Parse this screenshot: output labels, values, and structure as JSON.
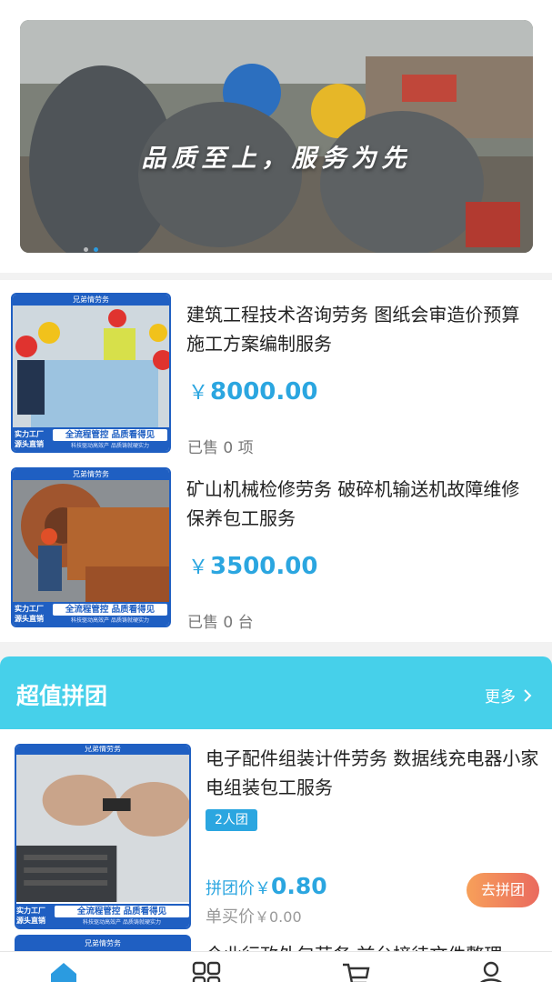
{
  "banner": {
    "slogan": "品质至上，服务为先",
    "dots": 2,
    "active_dot": 1
  },
  "products": [
    {
      "thumb_brand": "兄弟情劳务",
      "thumb_badge_left": "实力工厂 源头直销",
      "thumb_badge_right": "全流程管控 品质看得见",
      "thumb_badge_sub": "科技驱动高效产 品质铸就硬实力",
      "title": "建筑工程技术咨询劳务 图纸会审造价预算施工方案编制服务",
      "price_symbol": "￥",
      "price": "8000.00",
      "sold": "已售 0 项"
    },
    {
      "thumb_brand": "兄弟情劳务",
      "thumb_badge_left": "实力工厂 源头直销",
      "thumb_badge_right": "全流程管控 品质看得见",
      "thumb_badge_sub": "科技驱动高效产 品质铸就硬实力",
      "title": "矿山机械检修劳务 破碎机输送机故障维修保养包工服务",
      "price_symbol": "￥",
      "price": "3500.00",
      "sold": "已售 0 台"
    }
  ],
  "group_buy": {
    "title": "超值拼团",
    "more": "更多",
    "item": {
      "thumb_brand": "兄弟情劳务",
      "thumb_badge_left": "实力工厂 源头直销",
      "thumb_badge_right": "全流程管控 品质看得见",
      "thumb_badge_sub": "科技驱动高效产 品质铸就硬实力",
      "title": "电子配件组装计件劳务 数据线充电器小家电组装包工服务",
      "tag": "2人团",
      "group_price_label": "拼团价",
      "group_price_symbol": "￥",
      "group_price": "0.80",
      "single_price_label": "单买价",
      "single_price": "￥0.00",
      "button": "去拼团"
    },
    "next_item": {
      "thumb_brand": "兄弟情劳务",
      "title": "企业行政外包劳务 前台接待文件整理"
    }
  },
  "tabbar": {
    "icons": [
      "home-icon",
      "category-icon",
      "cart-icon",
      "profile-icon"
    ],
    "active_color": "#2b9be0"
  },
  "colors": {
    "accent": "#2ba6e0",
    "group_header": "#46d0ea",
    "brand_blue": "#1f5fc2"
  }
}
